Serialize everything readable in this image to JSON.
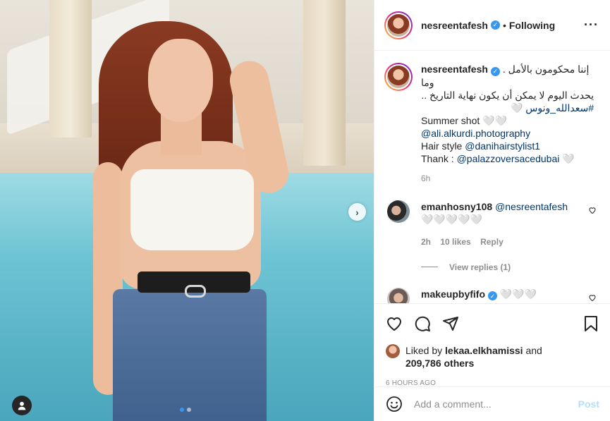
{
  "header": {
    "username": "nesreentafesh",
    "separator": "•",
    "follow_status": "Following",
    "more_icon": "more-horizontal-icon"
  },
  "caption": {
    "username": "nesreentafesh",
    "line1": "إننا محكومون بالأمل . وما",
    "line2": "يحدث اليوم لا يمكن أن يكون نهاية التاريخ ..",
    "hashtag": "#سعدالله_ونوس 🤍",
    "summer": "Summer shot 🤍🤍",
    "photographer": "@ali.alkurdi.photography",
    "hair_label": "Hair style ",
    "hair_tag": "@danihairstylist1",
    "thank_label": "Thank : ",
    "thank_tag": "@palazzoversacedubai",
    "thank_emoji": " 🤍",
    "time": "6h"
  },
  "comments": [
    {
      "username": "emanhosny108",
      "mention": "@nesreentafesh",
      "text": "🤍🤍🤍🤍🤍",
      "time": "2h",
      "likes": "10 likes",
      "reply": "Reply",
      "view_replies": "View replies (1)"
    },
    {
      "username": "makeupbyfifo",
      "text": "🤍🤍🤍"
    }
  ],
  "actions": {
    "liked_by_prefix": "Liked by ",
    "liked_by_user": "lekaa.elkhamissi",
    "liked_by_and": " and",
    "others": "209,786 others",
    "timestamp": "6 HOURS AGO"
  },
  "add_comment": {
    "placeholder": "Add a comment...",
    "post_label": "Post"
  },
  "colors": {
    "link": "#00376b",
    "verified": "#3897f0",
    "post_disabled": "#b2dffc"
  }
}
